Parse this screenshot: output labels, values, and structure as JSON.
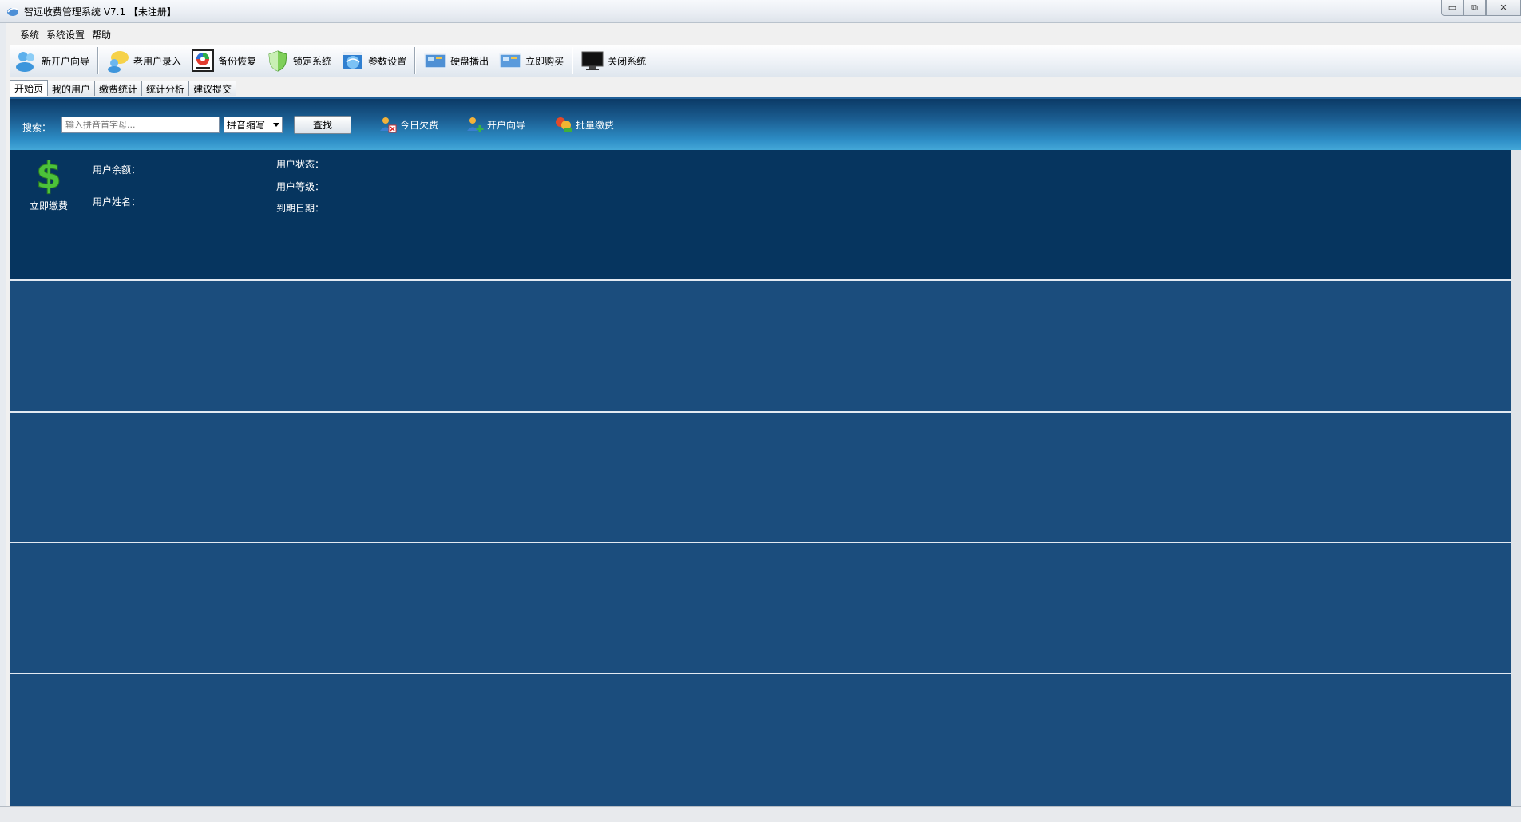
{
  "window": {
    "title": "智远收费管理系统 V7.1 【未注册】",
    "controls": {
      "minimize": "▭",
      "restore": "⧉",
      "close": "✕"
    }
  },
  "menu": [
    "系统",
    "系统设置",
    "帮助"
  ],
  "toolbar": {
    "items": [
      {
        "label": "新开户向导",
        "icon": "users-icon"
      },
      {
        "label": "老用户录入",
        "icon": "chat-user-icon"
      },
      {
        "label": "备份恢复",
        "icon": "backup-icon"
      },
      {
        "label": "锁定系统",
        "icon": "shield-icon"
      },
      {
        "label": "参数设置",
        "icon": "settings-globe-icon"
      },
      {
        "label": "硬盘播出",
        "icon": "disk-monitor-icon"
      },
      {
        "label": "立即购买",
        "icon": "buy-monitor-icon"
      },
      {
        "label": "关闭系统",
        "icon": "monitor-off-icon"
      }
    ]
  },
  "tabs": [
    "开始页",
    "我的用户",
    "缴费统计",
    "统计分析",
    "建议提交"
  ],
  "search": {
    "label": "搜索：",
    "placeholder": "输入拼音首字母...",
    "mode": "拼音缩写",
    "find_label": "查找",
    "actions": [
      {
        "label": "今日欠费",
        "icon": "user-debt-icon"
      },
      {
        "label": "开户向导",
        "icon": "user-add-icon"
      },
      {
        "label": "批量缴费",
        "icon": "batch-pay-icon"
      }
    ]
  },
  "user_panel": {
    "pay_label": "立即缴费",
    "balance_label": "用户余额：",
    "name_label": "用户姓名：",
    "status_label": "用户状态：",
    "level_label": "用户等级：",
    "expire_label": "到期日期："
  }
}
